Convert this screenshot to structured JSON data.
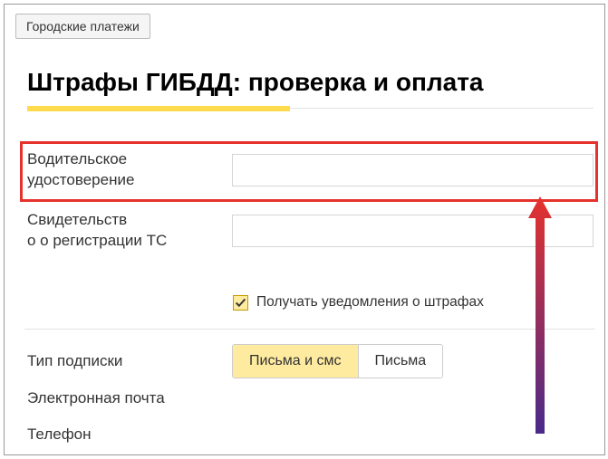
{
  "top_button": "Городские платежи",
  "heading": "Штрафы ГИБДД: проверка и оплата",
  "fields": {
    "driver_license": {
      "label": "Водительское удостоверение",
      "value": ""
    },
    "registration": {
      "label": "Свидетельство о регистрации ТС",
      "value": ""
    }
  },
  "checkbox": {
    "checked": true,
    "label": "Получать уведомления о штрафах"
  },
  "subscription": {
    "type_label": "Тип подписки",
    "options": {
      "both": "Письма и смс",
      "letters": "Письма"
    },
    "selected": "both",
    "email_label": "Электронная почта",
    "phone_label": "Телефон"
  },
  "colors": {
    "accent_yellow": "#ffdb4d",
    "highlight_red": "#e5322d",
    "check_fill": "#ffeba0",
    "arrow_top": "#e5322d",
    "arrow_bottom": "#7b1fa2"
  }
}
